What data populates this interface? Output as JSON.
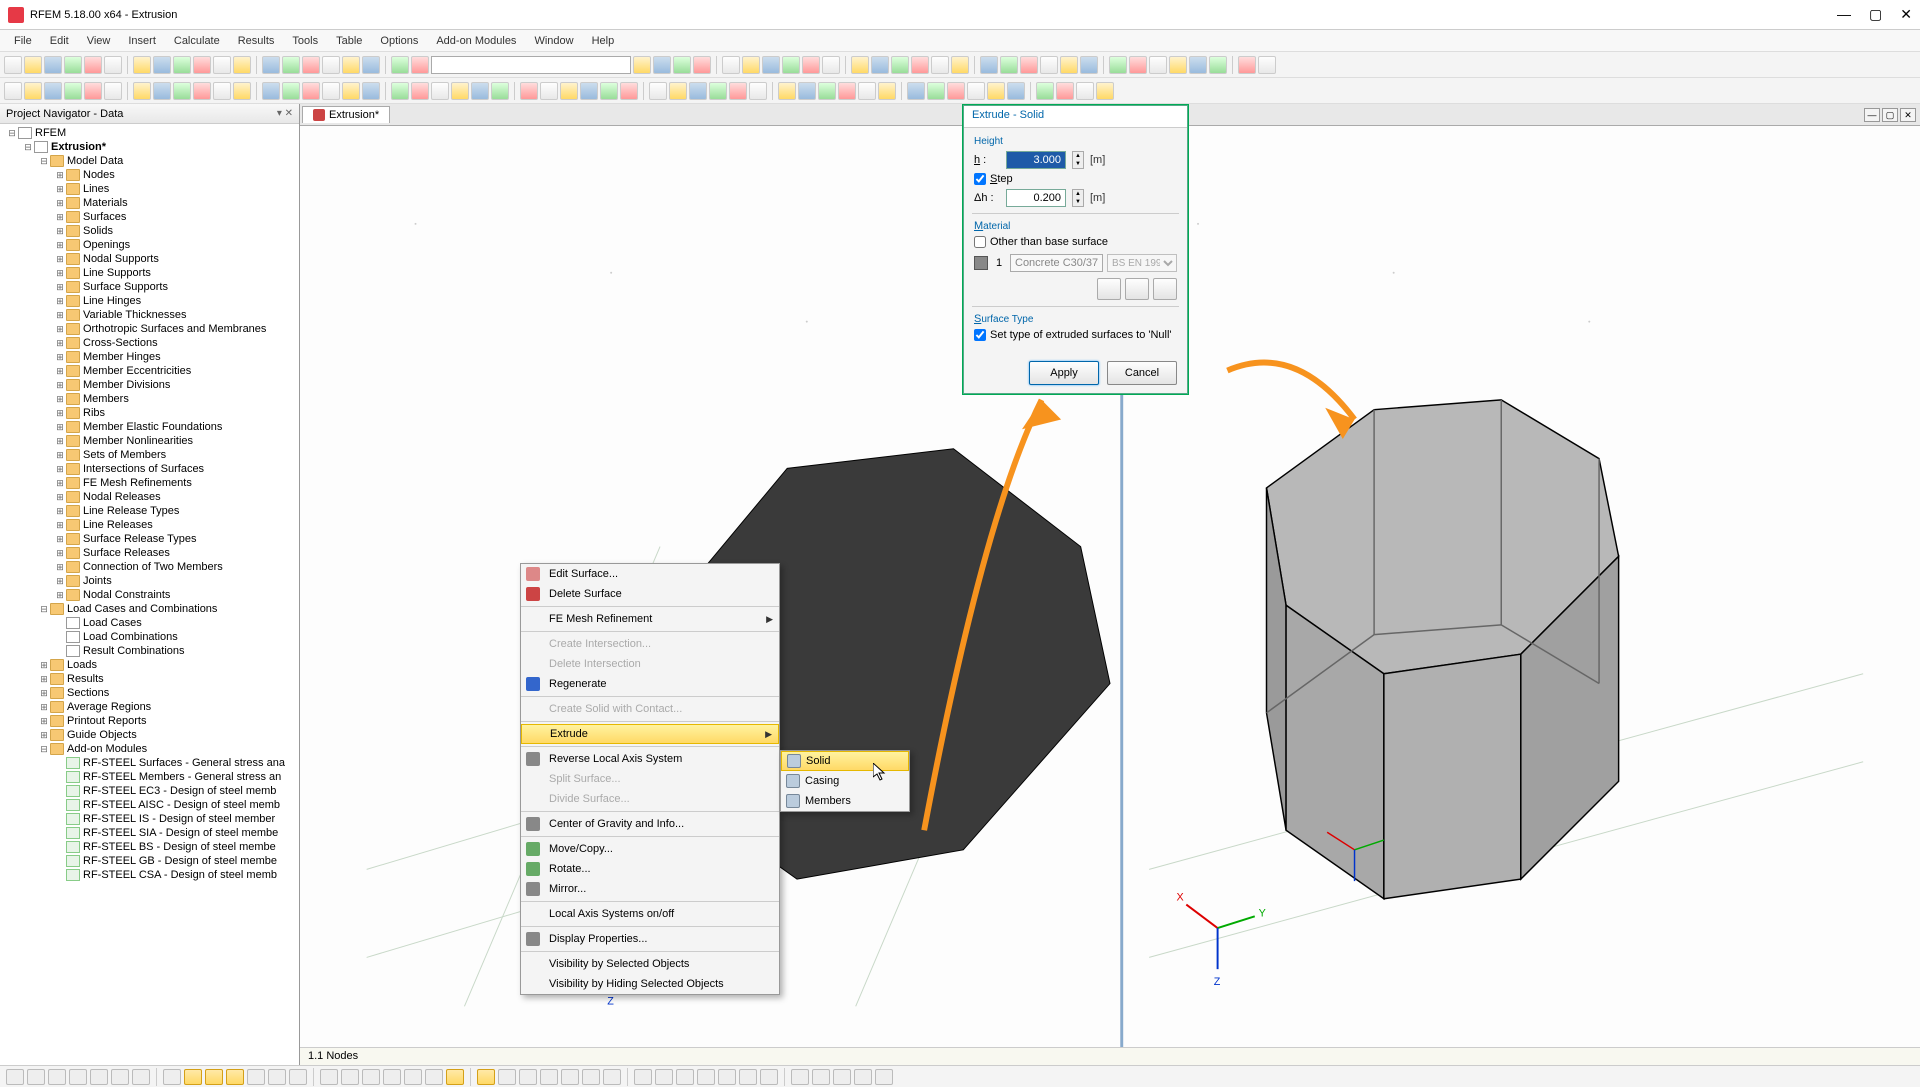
{
  "title": "RFEM 5.18.00 x64 - Extrusion",
  "menus": [
    "File",
    "Edit",
    "View",
    "Insert",
    "Calculate",
    "Results",
    "Tools",
    "Table",
    "Options",
    "Add-on Modules",
    "Window",
    "Help"
  ],
  "navigator": {
    "title": "Project Navigator - Data",
    "root": "RFEM",
    "model": "Extrusion*",
    "model_data": "Model Data",
    "items": [
      "Nodes",
      "Lines",
      "Materials",
      "Surfaces",
      "Solids",
      "Openings",
      "Nodal Supports",
      "Line Supports",
      "Surface Supports",
      "Line Hinges",
      "Variable Thicknesses",
      "Orthotropic Surfaces and Membranes",
      "Cross-Sections",
      "Member Hinges",
      "Member Eccentricities",
      "Member Divisions",
      "Members",
      "Ribs",
      "Member Elastic Foundations",
      "Member Nonlinearities",
      "Sets of Members",
      "Intersections of Surfaces",
      "FE Mesh Refinements",
      "Nodal Releases",
      "Line Release Types",
      "Line Releases",
      "Surface Release Types",
      "Surface Releases",
      "Connection of Two Members",
      "Joints",
      "Nodal Constraints"
    ],
    "load_group": "Load Cases and Combinations",
    "load_items": [
      "Load Cases",
      "Load Combinations",
      "Result Combinations"
    ],
    "other_groups": [
      "Loads",
      "Results",
      "Sections",
      "Average Regions",
      "Printout Reports",
      "Guide Objects",
      "Add-on Modules"
    ],
    "addons": [
      "RF-STEEL Surfaces - General stress ana",
      "RF-STEEL Members - General stress an",
      "RF-STEEL EC3 - Design of steel memb",
      "RF-STEEL AISC - Design of steel memb",
      "RF-STEEL IS - Design of steel member",
      "RF-STEEL SIA - Design of steel membe",
      "RF-STEEL BS - Design of steel membe",
      "RF-STEEL GB - Design of steel membe",
      "RF-STEEL CSA - Design of steel memb"
    ]
  },
  "viewport": {
    "tab": "Extrusion*",
    "nodes_label": "1.1 Nodes"
  },
  "context_menu": {
    "items": [
      {
        "label": "Edit Surface...",
        "icon": "#d88"
      },
      {
        "label": "Delete Surface",
        "icon": "#c44"
      },
      {
        "sep": true
      },
      {
        "label": "FE Mesh Refinement",
        "sub": true
      },
      {
        "sep": true
      },
      {
        "label": "Create Intersection...",
        "disabled": true
      },
      {
        "label": "Delete Intersection",
        "disabled": true
      },
      {
        "label": "Regenerate",
        "icon": "#36c"
      },
      {
        "sep": true
      },
      {
        "label": "Create Solid with Contact...",
        "disabled": true
      },
      {
        "sep": true
      },
      {
        "label": "Extrude",
        "sub": true,
        "highlight": true
      },
      {
        "sep": true
      },
      {
        "label": "Reverse Local Axis System",
        "icon": "#888"
      },
      {
        "label": "Split Surface...",
        "disabled": true
      },
      {
        "label": "Divide Surface...",
        "disabled": true
      },
      {
        "sep": true
      },
      {
        "label": "Center of Gravity and Info...",
        "icon": "#888"
      },
      {
        "sep": true
      },
      {
        "label": "Move/Copy...",
        "icon": "#6a6"
      },
      {
        "label": "Rotate...",
        "icon": "#6a6"
      },
      {
        "label": "Mirror...",
        "icon": "#888"
      },
      {
        "sep": true
      },
      {
        "label": "Local Axis Systems on/off"
      },
      {
        "sep": true
      },
      {
        "label": "Display Properties...",
        "icon": "#888"
      },
      {
        "sep": true
      },
      {
        "label": "Visibility by Selected Objects"
      },
      {
        "label": "Visibility by Hiding Selected Objects"
      }
    ]
  },
  "submenu": {
    "items": [
      {
        "label": "Solid",
        "highlight": true
      },
      {
        "label": "Casing"
      },
      {
        "label": "Members"
      }
    ]
  },
  "dialog": {
    "title": "Extrude - Solid",
    "height_label": "Height",
    "h_label": "h :",
    "h_value": "3.000",
    "h_unit": "[m]",
    "step_label": "Step",
    "dh_label": "Δh :",
    "dh_value": "0.200",
    "dh_unit": "[m]",
    "material_label": "Material",
    "other_label": "Other than base surface",
    "mat_num": "1",
    "mat_name": "Concrete C30/37",
    "mat_std": "BS EN 199",
    "surface_type_label": "Surface Type",
    "null_label": "Set type of extruded surfaces to 'Null'",
    "apply": "Apply",
    "cancel": "Cancel"
  }
}
